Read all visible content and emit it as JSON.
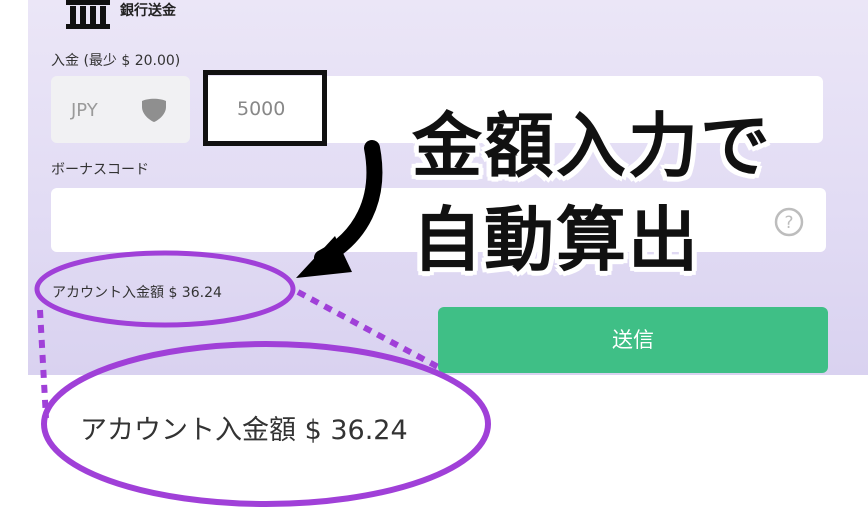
{
  "bank": {
    "label": "銀行送金",
    "icon": "bank-icon"
  },
  "deposit": {
    "label": "入金 (最少 $ 20.00)",
    "currency": "JPY",
    "currency_icon": "shield-icon",
    "amount_value": "5000"
  },
  "bonus": {
    "label": "ボーナスコード",
    "value": "",
    "help_icon": "help-circle-icon"
  },
  "account": {
    "label_and_amount": "アカウント入金額 $ 36.24"
  },
  "send_button": {
    "label": "送信"
  },
  "overlay": {
    "line1": "金額入力で",
    "line2": "自動算出"
  },
  "zoom": {
    "text": "アカウント入金額 $ 36.24"
  },
  "colors": {
    "panel_bg": "#e6e1f6",
    "button": "#3fbf86",
    "annotation": "#a040d8",
    "highlight": "#111111"
  }
}
